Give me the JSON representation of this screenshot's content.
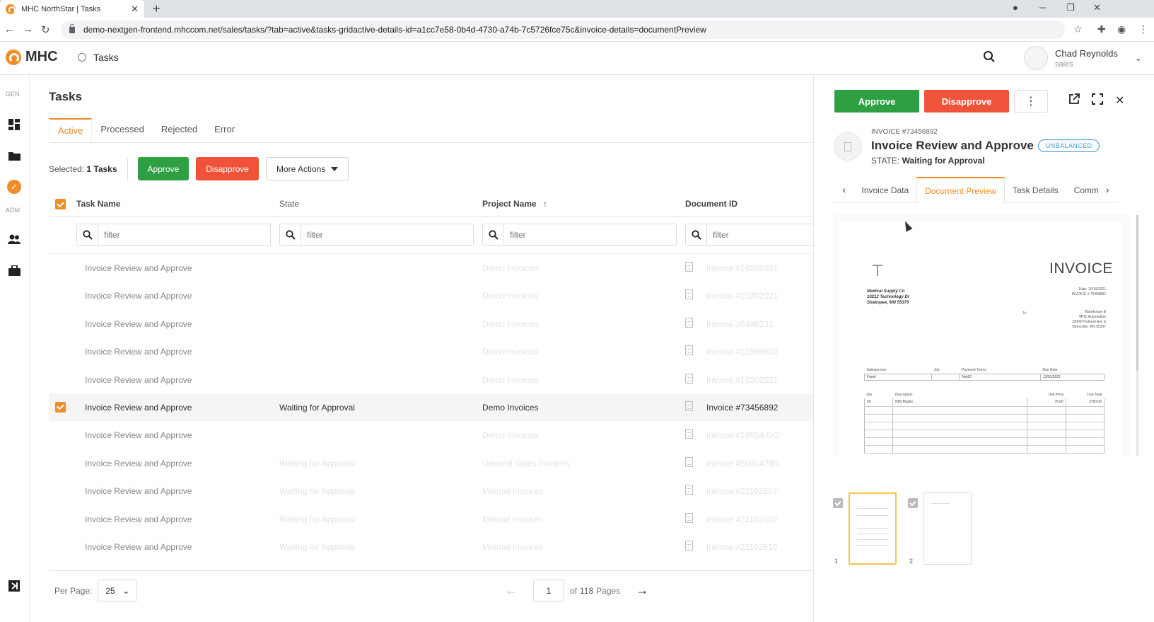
{
  "browser": {
    "tab_title": "MHC NorthStar | Tasks",
    "url": "demo-nextgen-frontend.mhccom.net/sales/tasks/?tab=active&tasks-gridactive-details-id=a1cc7e58-0b4d-4730-a74b-7c5726fce75c&invoice-details=documentPreview"
  },
  "header": {
    "logo_text": "MHC",
    "page_crumb": "Tasks",
    "user_name": "Chad Reynolds",
    "user_role": "sales"
  },
  "rail": {
    "gen_label": "GEN",
    "adm_label": "ADM"
  },
  "main": {
    "title": "Tasks",
    "tabs": [
      "Active",
      "Processed",
      "Rejected",
      "Error"
    ],
    "selected_prefix": "Selected:",
    "selected_count": "1 Tasks",
    "approve": "Approve",
    "disapprove": "Disapprove",
    "more_actions": "More Actions"
  },
  "grid": {
    "columns": [
      "Task Name",
      "State",
      "Project Name",
      "Document ID"
    ],
    "filter_placeholder": "filter",
    "rows": [
      {
        "task": "Invoice Review and Approve",
        "state": "",
        "project": "Demo Invoices",
        "doc": "Invoice #10202021"
      },
      {
        "task": "Invoice Review and Approve",
        "state": "",
        "project": "Demo Invoices",
        "doc": "Invoice #10202021"
      },
      {
        "task": "Invoice Review and Approve",
        "state": "",
        "project": "Demo Invoices",
        "doc": "Invoice #6486231"
      },
      {
        "task": "Invoice Review and Approve",
        "state": "",
        "project": "Demo Invoices",
        "doc": "Invoice #11598639"
      },
      {
        "task": "Invoice Review and Approve",
        "state": "",
        "project": "Demo Invoices",
        "doc": "Invoice #10202021"
      },
      {
        "task": "Invoice Review and Approve",
        "state": "Waiting for Approval",
        "project": "Demo Invoices",
        "doc": "Invoice #73456892"
      },
      {
        "task": "Invoice Review and Approve",
        "state": "",
        "project": "Demo Invoices",
        "doc": "Invoice #19654-DO"
      },
      {
        "task": "Invoice Review and Approve",
        "state": "Waiting for Approval",
        "project": "General Sales Invoices",
        "doc": "Invoice #50014785"
      },
      {
        "task": "Invoice Review and Approve",
        "state": "Waiting for Approval",
        "project": "Manual Invoices",
        "doc": "Invoice #21102607"
      },
      {
        "task": "Invoice Review and Approve",
        "state": "Waiting for Approval",
        "project": "Manual Invoices",
        "doc": "Invoice #21102602"
      },
      {
        "task": "Invoice Review and Approve",
        "state": "Waiting for Approval",
        "project": "Manual Invoices",
        "doc": "Invoice #21102610"
      }
    ]
  },
  "footer": {
    "per_page_label": "Per Page:",
    "per_page_value": "25",
    "page_current": "1",
    "page_of": "of",
    "page_total": "118",
    "pages_label": "Pages"
  },
  "panel": {
    "approve": "Approve",
    "disapprove": "Disapprove",
    "invoice_label": "INVOICE #73456892",
    "title": "Invoice Review and Approve",
    "badge": "UNBALANCED",
    "state_label": "STATE:",
    "state_value": "Waiting for Approval",
    "tabs": [
      "Invoice Data",
      "Document Preview",
      "Task Details",
      "Comm"
    ],
    "thumb_numbers": [
      "1",
      "2"
    ]
  },
  "invoice_doc": {
    "title": "INVOICE",
    "from": [
      "Medical Supply Co",
      "10212 Technology Dr",
      "Shakopee, MN 55379"
    ],
    "date_line": "Date: 10/15/2021",
    "number_line": "INVOICE # 73456892",
    "to_label": "To",
    "to": [
      "Warehouse B",
      "MHC Automation",
      "12000 Portland Ave S",
      "Burnsville, MN 55337"
    ],
    "headers": [
      "Salesperson",
      "Job",
      "Payment Terms",
      "Due Date"
    ],
    "values": [
      "Frank",
      "",
      "Net60",
      "12/01/2021"
    ],
    "line_headers": [
      "Qty",
      "Description",
      "Unit Price",
      "Line Total"
    ],
    "line": [
      "50",
      "N95 Masks",
      "75.00",
      "3750.00"
    ]
  }
}
